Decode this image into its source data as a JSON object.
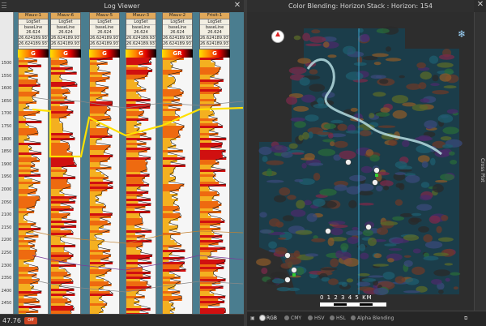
{
  "log_viewer": {
    "title": "Log Viewer",
    "close_glyph": "✕",
    "zoom_readout": "47.76",
    "footer_btn": "Off",
    "depth_labels": [
      "1500",
      "1550",
      "1600",
      "1650",
      "1700",
      "1750",
      "1800",
      "1850",
      "1900",
      "1950",
      "2000",
      "2050",
      "2100",
      "2150",
      "2200",
      "2250",
      "2300",
      "2350",
      "2400",
      "2450"
    ],
    "wells": [
      {
        "name": "Mauv-1",
        "set": "LogSet",
        "line1": "baseLine 26.624",
        "line2": "26.624189.937",
        "line3": "26.624189.937",
        "log": "G"
      },
      {
        "name": "Mauv-6",
        "set": "LogSet",
        "line1": "baseLine 26.624",
        "line2": "26.624189.937",
        "line3": "26.624189.937",
        "log": "G"
      },
      {
        "name": "Mauv-5",
        "set": "LogSet",
        "line1": "baseLine 26.624",
        "line2": "26.624189.937",
        "line3": "26.624189.937",
        "log": "G"
      },
      {
        "name": "Mauv-3",
        "set": "LogSet",
        "line1": "baseLine 26.624",
        "line2": "26.624189.937",
        "line3": "26.624189.937",
        "log": "G"
      },
      {
        "name": "Mauv-2",
        "set": "LogSet",
        "line1": "baseLine 26.624",
        "line2": "26.624189.937",
        "line3": "26.624189.937",
        "log": "GR"
      },
      {
        "name": "Frisit-1",
        "set": "LogSet",
        "line1": "baseLine 26.624",
        "line2": "26.624189.937",
        "line3": "26.624189.937",
        "log": "G"
      }
    ]
  },
  "color_blending": {
    "title": "Color Blending: Horizon Stack : Horizon: 154",
    "close_glyph": "✕",
    "sidebar_tab": "Cross Plot",
    "scale_text": "0  1  2  3  4  5 KM",
    "snow_glyph": "❄",
    "modes": [
      {
        "label": "RGB",
        "active": true
      },
      {
        "label": "CMY",
        "active": false
      },
      {
        "label": "HSV",
        "active": false
      },
      {
        "label": "HSL",
        "active": false
      },
      {
        "label": "Alpha Blending",
        "active": false
      }
    ],
    "colors": {
      "accent": "#4a7d8f",
      "horizon": "#ffe000",
      "log_fill": "#e06010"
    }
  }
}
